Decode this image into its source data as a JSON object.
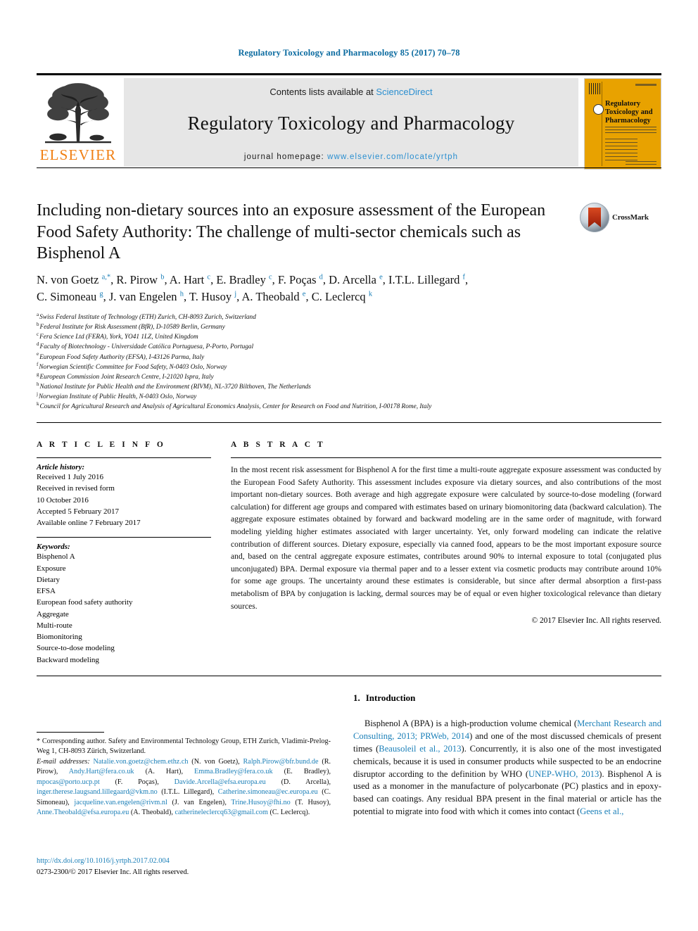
{
  "running_head": "Regulatory Toxicology and Pharmacology 85 (2017) 70–78",
  "colors": {
    "link_blue": "#1a7fb8",
    "sciencedirect_blue": "#2b8fd0",
    "elsevier_orange": "#f07f13",
    "cover_yellow": "#e8a200"
  },
  "masthead": {
    "publisher_name": "ELSEVIER",
    "contents_prefix": "Contents lists available at ",
    "contents_link": "ScienceDirect",
    "journal_name": "Regulatory Toxicology and Pharmacology",
    "homepage_label": "journal homepage: ",
    "homepage_url": "www.elsevier.com/locate/yrtph",
    "cover_title": "Regulatory Toxicology and Pharmacology"
  },
  "article": {
    "title": "Including non-dietary sources into an exposure assessment of the European Food Safety Authority: The challenge of multi-sector chemicals such as Bisphenol A",
    "crossmark_label": "CrossMark",
    "authors_line_1": "N. von Goetz a,*, R. Pirow b, A. Hart c, E. Bradley c, F. Poças d, D. Arcella e, I.T.L. Lillegard f,",
    "authors_line_2": "C. Simoneau g, J. van Engelen h, T. Husoy j, A. Theobald e, C. Leclercq k",
    "authors": [
      {
        "name": "N. von Goetz",
        "marks": "a, *"
      },
      {
        "name": "R. Pirow",
        "marks": "b"
      },
      {
        "name": "A. Hart",
        "marks": "c"
      },
      {
        "name": "E. Bradley",
        "marks": "c"
      },
      {
        "name": "F. Poças",
        "marks": "d"
      },
      {
        "name": "D. Arcella",
        "marks": "e"
      },
      {
        "name": "I.T.L. Lillegard",
        "marks": "f"
      },
      {
        "name": "C. Simoneau",
        "marks": "g"
      },
      {
        "name": "J. van Engelen",
        "marks": "h"
      },
      {
        "name": "T. Husoy",
        "marks": "j"
      },
      {
        "name": "A. Theobald",
        "marks": "e"
      },
      {
        "name": "C. Leclercq",
        "marks": "k"
      }
    ],
    "affiliations": [
      {
        "mark": "a",
        "text": "Swiss Federal Institute of Technology (ETH) Zurich, CH-8093 Zurich, Switzerland"
      },
      {
        "mark": "b",
        "text": "Federal Institute for Risk Assessment (BfR), D-10589 Berlin, Germany"
      },
      {
        "mark": "c",
        "text": "Fera Science Ltd (FERA), York, YO41 1LZ, United Kingdom"
      },
      {
        "mark": "d",
        "text": "Faculty of Biotechnology - Universidade Católica Portuguesa, P-Porto, Portugal"
      },
      {
        "mark": "e",
        "text": "European Food Safety Authority (EFSA), I-43126 Parma, Italy"
      },
      {
        "mark": "f",
        "text": "Norwegian Scientific Committee for Food Safety, N-0403 Oslo, Norway"
      },
      {
        "mark": "g",
        "text": "European Commission Joint Research Centre, I-21020 Ispra, Italy"
      },
      {
        "mark": "h",
        "text": "National Institute for Public Health and the Environment (RIVM), NL-3720 Bilthoven, The Netherlands"
      },
      {
        "mark": "j",
        "text": "Norwegian Institute of Public Health, N-0403 Oslo, Norway"
      },
      {
        "mark": "k",
        "text": "Council for Agricultural Research and Analysis of Agricultural Economics Analysis, Center for Research on Food and Nutrition, I-00178 Rome, Italy"
      }
    ]
  },
  "article_info": {
    "heading": "A R T I C L E   I N F O",
    "history_label": "Article history:",
    "history": [
      "Received 1 July 2016",
      "Received in revised form",
      "10 October 2016",
      "Accepted 5 February 2017",
      "Available online 7 February 2017"
    ],
    "keywords_label": "Keywords:",
    "keywords": [
      "Bisphenol A",
      "Exposure",
      "Dietary",
      "EFSA",
      "European food safety authority",
      "Aggregate",
      "Multi-route",
      "Biomonitoring",
      "Source-to-dose modeling",
      "Backward modeling"
    ]
  },
  "abstract": {
    "heading": "A B S T R A C T",
    "body": "In the most recent risk assessment for Bisphenol A for the first time a multi-route aggregate exposure assessment was conducted by the European Food Safety Authority. This assessment includes exposure via dietary sources, and also contributions of the most important non-dietary sources. Both average and high aggregate exposure were calculated by source-to-dose modeling (forward calculation) for different age groups and compared with estimates based on urinary biomonitoring data (backward calculation). The aggregate exposure estimates obtained by forward and backward modeling are in the same order of magnitude, with forward modeling yielding higher estimates associated with larger uncertainty. Yet, only forward modeling can indicate the relative contribution of different sources. Dietary exposure, especially via canned food, appears to be the most important exposure source and, based on the central aggregate exposure estimates, contributes around 90% to internal exposure to total (conjugated plus unconjugated) BPA. Dermal exposure via thermal paper and to a lesser extent via cosmetic products may contribute around 10% for some age groups. The uncertainty around these estimates is considerable, but since after dermal absorption a first-pass metabolism of BPA by conjugation is lacking, dermal sources may be of equal or even higher toxicological relevance than dietary sources.",
    "copyright": "© 2017 Elsevier Inc. All rights reserved."
  },
  "footnote": {
    "corresponding": "* Corresponding author. Safety and Environmental Technology Group, ETH Zurich, Vladimir-Prelog-Weg 1, CH-8093 Zürich, Switzerland.",
    "emails_label": "E-mail addresses:",
    "emails": [
      {
        "address": "Natalie.von.goetz@chem.ethz.ch",
        "owner": "(N. von Goetz)"
      },
      {
        "address": "Ralph.Pirow@bfr.bund.de",
        "owner": "(R. Pirow)"
      },
      {
        "address": "Andy.Hart@fera.co.uk",
        "owner": "(A. Hart)"
      },
      {
        "address": "Emma.Bradley@fera.co.uk",
        "owner": "(E. Bradley)"
      },
      {
        "address": "mpocas@porto.ucp.pt",
        "owner": "(F. Poças)"
      },
      {
        "address": "Davide.Arcella@efsa.europa.eu",
        "owner": "(D. Arcella)"
      },
      {
        "address": "inger.therese.laugsand.lillegaard@vkm.no",
        "owner": "(I.T.L. Lillegard)"
      },
      {
        "address": "Catherine.simoneau@ec.europa.eu",
        "owner": "(C. Simoneau)"
      },
      {
        "address": "jacqueline.van.engelen@rivm.nl",
        "owner": "(J. van Engelen)"
      },
      {
        "address": "Trine.Husoy@fhi.no",
        "owner": "(T. Husoy)"
      },
      {
        "address": "Anne.Theobald@efsa.europa.eu",
        "owner": "(A. Theobald)"
      },
      {
        "address": "catherineleclercq63@gmail.com",
        "owner": "(C. Leclercq)"
      }
    ]
  },
  "doi_block": {
    "doi_url": "http://dx.doi.org/10.1016/j.yrtph.2017.02.004",
    "issn_line": "0273-2300/© 2017 Elsevier Inc. All rights reserved."
  },
  "introduction": {
    "number": "1.",
    "heading": "Introduction",
    "paragraph_text": "Bisphenol A (BPA) is a high-production volume chemical (Merchant Research and Consulting, 2013; PRWeb, 2014) and one of the most discussed chemicals of present times (Beausoleil et al., 2013). Concurrently, it is also one of the most investigated chemicals, because it is used in consumer products while suspected to be an endocrine disruptor according to the definition by WHO (UNEP-WHO, 2013). Bisphenol A is used as a monomer in the manufacture of polycarbonate (PC) plastics and in epoxy-based can coatings. Any residual BPA present in the final material or article has the potential to migrate into food with which it comes into contact (Geens et al.,",
    "citations": [
      "Merchant Research and Consulting, 2013; PRWeb, 2014",
      "Beausoleil et al., 2013",
      "UNEP-WHO, 2013",
      "Geens et al.,"
    ]
  }
}
